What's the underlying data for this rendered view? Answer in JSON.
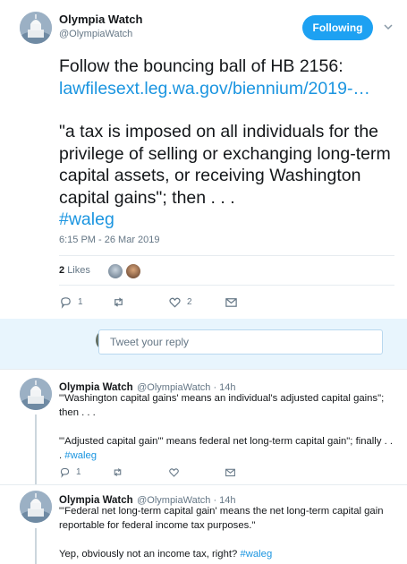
{
  "tweet": {
    "author": {
      "name": "Olympia Watch",
      "handle": "@OlympiaWatch"
    },
    "follow_label": "Following",
    "text_line1": "Follow the bouncing ball of HB 2156:",
    "link": "lawfilesext.leg.wa.gov/biennium/2019-…",
    "quote": "\"a tax is imposed on all individuals for the privilege of selling or exchanging long-term capital assets, or receiving Washington capital gains\"; then . . .",
    "hashtag": "#waleg",
    "timestamp": "6:15 PM - 26 Mar 2019",
    "likes_count": "2",
    "likes_label": "Likes",
    "reply_count": "1",
    "like_action_count": "2"
  },
  "reply_box": {
    "placeholder": "Tweet your reply"
  },
  "replies": [
    {
      "name": "Olympia Watch",
      "handle": "@OlympiaWatch · 14h",
      "text": "\"'Washington capital gains' means an individual's adjusted capital gains\"; then . . .\n\n\"'Adjusted capital gain'\" means federal net long-term capital gain\"; finally . . .",
      "hashtag": "#waleg",
      "reply_count": "1"
    },
    {
      "name": "Olympia Watch",
      "handle": "@OlympiaWatch · 14h",
      "text": "\"'Federal net long-term capital gain' means the net long-term capital gain reportable for federal income tax purposes.\"\n\nYep, obviously not an income tax, right?",
      "hashtag": "#waleg"
    }
  ],
  "colors": {
    "accent": "#1da1f2",
    "link": "#1b95e0",
    "secondary_text": "#657786"
  }
}
